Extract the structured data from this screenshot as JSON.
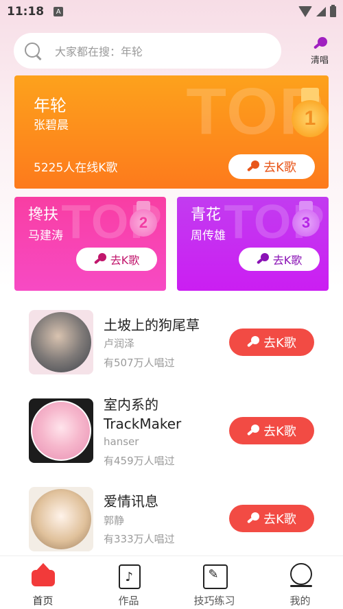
{
  "status_bar": {
    "time": "11:18",
    "notification_icon": "A"
  },
  "search": {
    "placeholder": "大家都在搜：年轮"
  },
  "clear_sing": {
    "label": "清唱"
  },
  "top_cards": [
    {
      "rank": "1",
      "bg_text": "TOP",
      "title": "年轮",
      "artist": "张碧晨",
      "online": "5225人在线K歌",
      "button": "去K歌",
      "color": "#fd8f1c"
    },
    {
      "rank": "2",
      "bg_text": "TOP",
      "title": "搀扶",
      "artist": "马建涛",
      "button": "去K歌",
      "color": "#f83ea3"
    },
    {
      "rank": "3",
      "bg_text": "TOP",
      "title": "青花",
      "artist": "周传雄",
      "button": "去K歌",
      "color": "#c42af0"
    }
  ],
  "songs": [
    {
      "title": "土坡上的狗尾草",
      "artist": "卢润泽",
      "count": "有507万人唱过",
      "button": "去K歌"
    },
    {
      "title": "室内系的TrackMaker",
      "title_line1": "室内系的",
      "title_line2": "TrackMaker",
      "artist": "hanser",
      "count": "有459万人唱过",
      "button": "去K歌"
    },
    {
      "title": "爱情讯息",
      "artist": "郭静",
      "count": "有333万人唱过",
      "button": "去K歌"
    }
  ],
  "bottom_nav": [
    {
      "label": "首页",
      "icon": "home-icon",
      "active": true
    },
    {
      "label": "作品",
      "icon": "works-icon"
    },
    {
      "label": "技巧练习",
      "icon": "skill-icon"
    },
    {
      "label": "我的",
      "icon": "profile-icon"
    }
  ],
  "colors": {
    "accent_red": "#f24b44",
    "orange": "#fd8f1c",
    "pink": "#f83ea3",
    "purple": "#c42af0"
  }
}
